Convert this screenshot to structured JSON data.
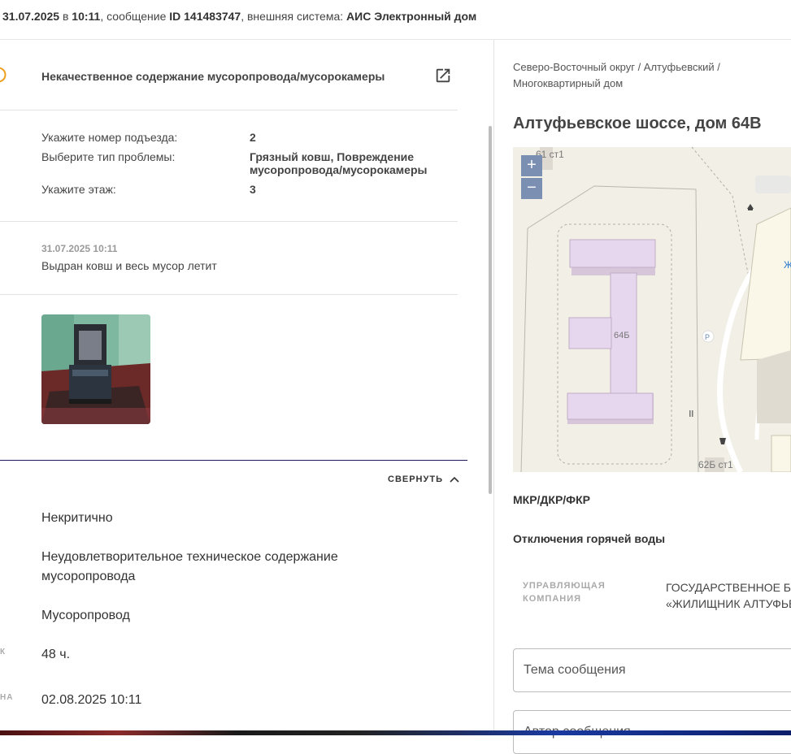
{
  "header": {
    "date": "31.07.2025",
    "in_word": "в",
    "time": "10:11",
    "message_prefix": ", сообщение",
    "message_id": "ID 141483747",
    "system_prefix": ", внешняя система:",
    "system_name": "АИС Электронный дом"
  },
  "problem": {
    "title": "Некачественное содержание мусоропровода/мусорокамеры"
  },
  "fields": [
    {
      "label": "Укажите номер подъезда:",
      "value": "2"
    },
    {
      "label": "Выберите тип проблемы:",
      "value": "Грязный ковш, Повреждение мусоропровода/мусорокамеры"
    },
    {
      "label": "Укажите этаж:",
      "value": "3"
    }
  ],
  "comment": {
    "date": "31.07.2025 10:11",
    "text": "Выдран ковш и весь мусор летит"
  },
  "collapse_label": "СВЕРНУТЬ",
  "details": {
    "criticality": "Некритично",
    "category": "Неудовлетворительное техническое содержание мусоропровода",
    "object": "Мусоропровод",
    "deadline_label_cut": "К",
    "deadline": "48 ч.",
    "due_label_cut": "НА",
    "due_date": "02.08.2025 10:11"
  },
  "right": {
    "breadcrumb": "Северо-Восточный округ / Алтуфьевский / Многоквартирный дом",
    "address": "Алтуфьевское шоссе, дом 64В",
    "map": {
      "label_61": "61 ст1",
      "label_64b": "64Б",
      "label_62b": "62Б ст1",
      "label_p": "P",
      "label_zh": "Ж",
      "zoom_in": "+",
      "zoom_out": "−"
    },
    "repair_title": "МКР/ДКР/ФКР",
    "hot_water_title": "Отключения горячей воды",
    "mgmt_label": "УПРАВЛЯЮЩАЯ КОМПАНИЯ",
    "mgmt_value_line1": "ГОСУДАРСТВЕННОЕ БЮ",
    "mgmt_value_line2": "«ЖИЛИЩНИК АЛТУФЬЕ",
    "subject_placeholder": "Тема сообщения",
    "author_placeholder": "Автор сообщения"
  },
  "colors": {
    "warning": "#f0a020",
    "accent_line": "#1a1a5e",
    "zoom_button": "#7b8fb3",
    "building": "#e6d6ee"
  }
}
